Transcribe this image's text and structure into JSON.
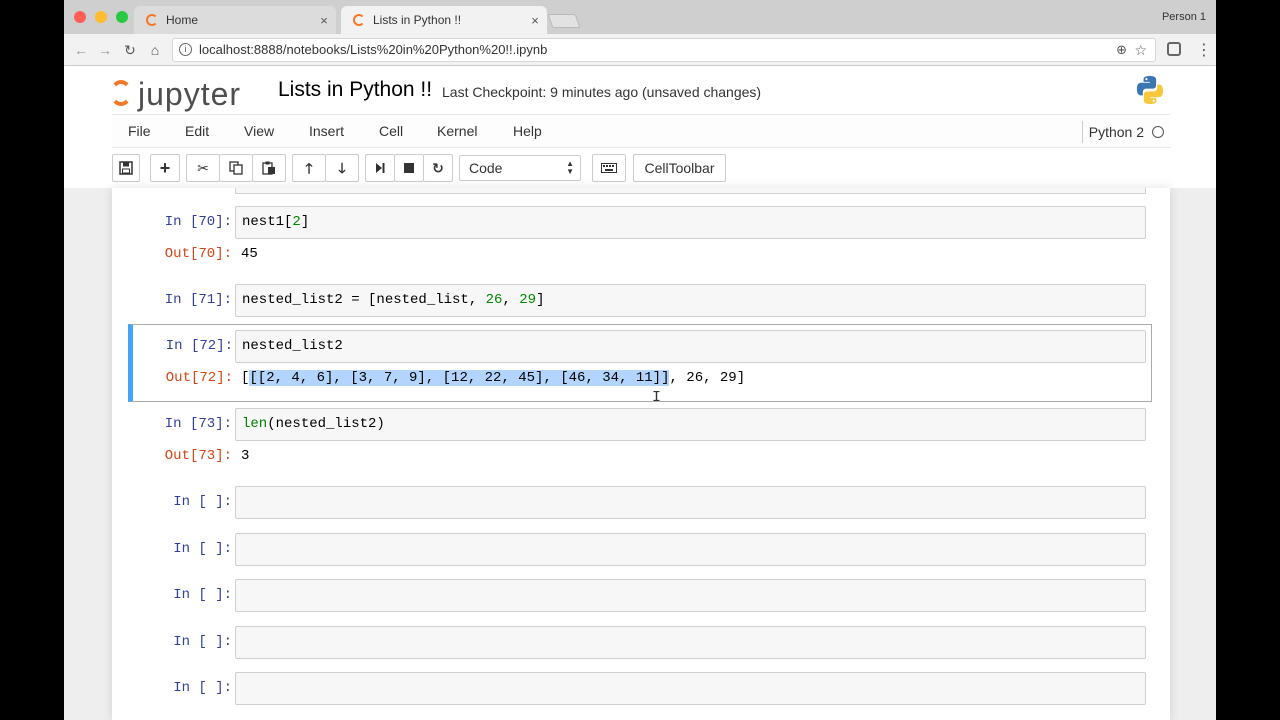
{
  "browser": {
    "tabs": [
      {
        "title": "Home",
        "close": "×"
      },
      {
        "title": "Lists in Python !!",
        "close": "×"
      }
    ],
    "profile": "Person 1",
    "url": "localhost:8888/notebooks/Lists%20in%20Python%20!!.ipynb",
    "icons": {
      "back": "arrow-left-icon",
      "forward": "arrow-right-icon",
      "reload": "reload-icon",
      "home": "home-icon"
    }
  },
  "header": {
    "logo_text": "jupyter",
    "title": "Lists in Python !!",
    "checkpoint": "Last Checkpoint: 9 minutes ago (unsaved changes)"
  },
  "menubar": {
    "items": [
      "File",
      "Edit",
      "View",
      "Insert",
      "Cell",
      "Kernel",
      "Help"
    ],
    "kernel": "Python 2"
  },
  "toolbar": {
    "cell_type": "Code",
    "celltoolbar": "CellToolbar",
    "icons": [
      "save-icon",
      "plus-icon",
      "scissors-icon",
      "copy-icon",
      "paste-icon",
      "arrow-up-icon",
      "arrow-down-icon",
      "run-icon",
      "stop-icon",
      "restart-icon",
      "keyboard-icon"
    ]
  },
  "cells": [
    {
      "prompt": "In [70]:",
      "code": [
        "nest1[",
        "2",
        "]"
      ],
      "out_prompt": "Out[70]:",
      "output": "45"
    },
    {
      "prompt": "In [71]:",
      "code": [
        "nested_list2 = [nested_list, ",
        "26",
        ", ",
        "29",
        "]"
      ]
    },
    {
      "prompt": "In [72]:",
      "code": "nested_list2",
      "out_prompt": "Out[72]:",
      "output": {
        "open": "[",
        "selected": "[[2, 4, 6], [3, 7, 9], [12, 22, 45], [46, 34, 11]]",
        "rest": ", 26, 29]"
      }
    },
    {
      "prompt": "In [73]:",
      "code": [
        "len",
        "(nested_list2)"
      ],
      "out_prompt": "Out[73]:",
      "output": "3"
    },
    {
      "prompt": "In [ ]:"
    },
    {
      "prompt": "In [ ]:"
    },
    {
      "prompt": "In [ ]:"
    },
    {
      "prompt": "In [ ]:"
    },
    {
      "prompt": "In [ ]:"
    }
  ],
  "colors": {
    "accent": "#f37726",
    "selected_cell": "#42a5f5",
    "in_prompt": "#303f9f",
    "out_prompt": "#d84315"
  }
}
